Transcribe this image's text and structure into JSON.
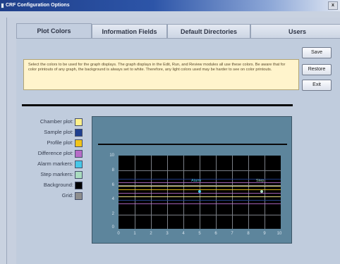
{
  "window": {
    "title": "CRF Configuration Options",
    "close_glyph": "x"
  },
  "tabs": [
    {
      "label": "Plot Colors",
      "active": true
    },
    {
      "label": "Information Fields",
      "active": false
    },
    {
      "label": "Default Directories",
      "active": false
    },
    {
      "label": "Users",
      "active": false
    }
  ],
  "info": {
    "text": "Select the colors to be used for the graph displays. The graph displays in the Edit, Run, and Review modules all use these colors. Be aware that for color printouts of any graph, the background is always set to white. Therefore, any light colors used may be harder to see on color printouts."
  },
  "buttons": {
    "save": "Save",
    "restore": "Restore",
    "exit": "Exit"
  },
  "legend": [
    {
      "label": "Chamber plot:",
      "color": "#fff08a"
    },
    {
      "label": "Sample plot:",
      "color": "#1f3f8f"
    },
    {
      "label": "Profile plot:",
      "color": "#f1c418"
    },
    {
      "label": "Difference plot:",
      "color": "#b66cc8"
    },
    {
      "label": "Alarm markers:",
      "color": "#46c7e8"
    },
    {
      "label": "Step markers:",
      "color": "#a9dcbf"
    },
    {
      "label": "Background:",
      "color": "#000000"
    },
    {
      "label": "Grid:",
      "color": "#8e8e8e"
    }
  ],
  "preview": {
    "alarm_label": "Alarm",
    "step_label": "Step",
    "y_ticks": [
      "10",
      "8",
      "6",
      "4",
      "2",
      "0"
    ],
    "x_ticks": [
      "0",
      "1",
      "2",
      "3",
      "4",
      "5",
      "6",
      "7",
      "8",
      "9",
      "10"
    ]
  }
}
